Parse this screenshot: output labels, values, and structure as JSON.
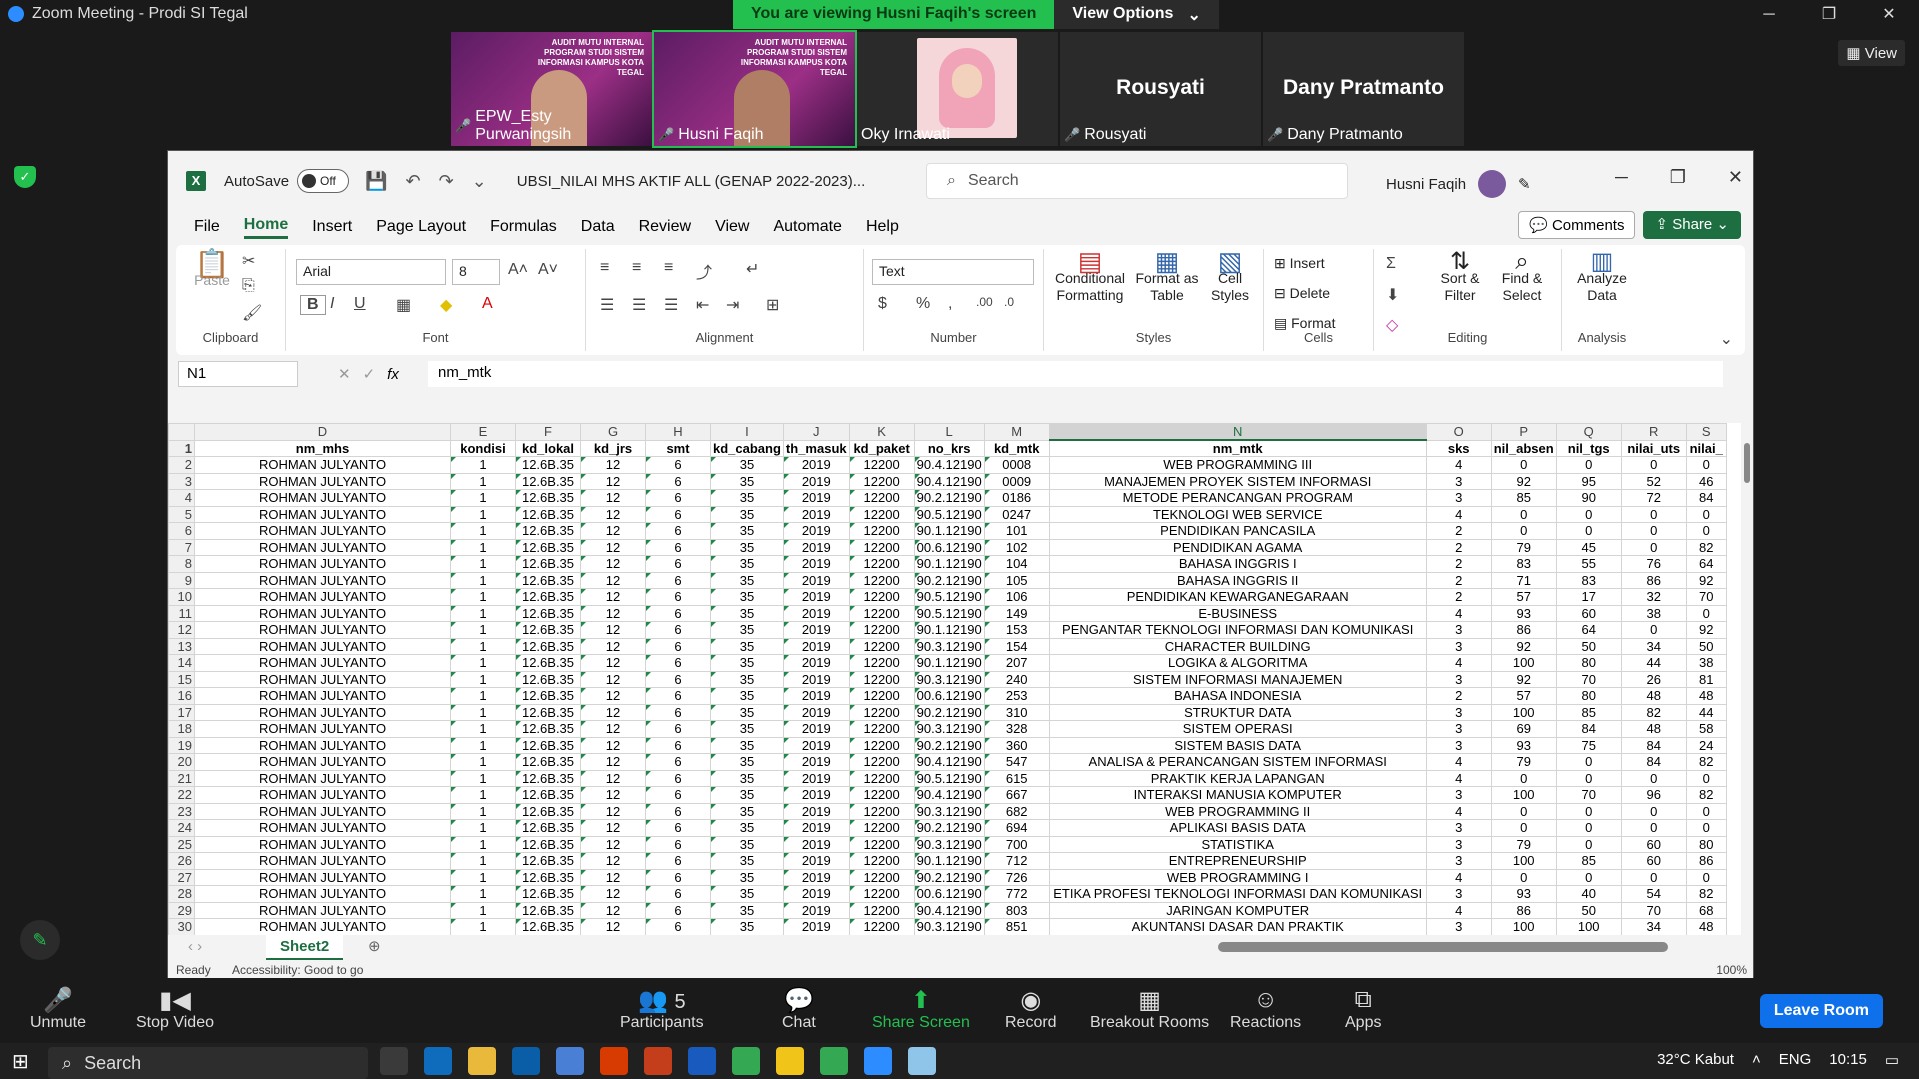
{
  "zoom": {
    "title": "Zoom Meeting - Prodi SI Tegal",
    "viewing": "You are viewing Husni Faqih's screen",
    "view_options": "View Options",
    "view": "View",
    "participants": [
      {
        "name": "EPW_Esty Purwaningsih",
        "type": "video",
        "header": "AUDIT MUTU INTERNAL PROGRAM STUDI SISTEM INFORMASI KAMPUS KOTA TEGAL"
      },
      {
        "name": "Husni Faqih",
        "type": "video",
        "header": "AUDIT MUTU INTERNAL PROGRAM STUDI SISTEM INFORMASI KAMPUS KOTA TEGAL"
      },
      {
        "name": "Oky Irnawati",
        "type": "photo",
        "header": ""
      },
      {
        "name": "Rousyati",
        "type": "name",
        "header": "Rousyati"
      },
      {
        "name": "Dany Pratmanto",
        "type": "name",
        "header": "Dany Pratmanto"
      }
    ],
    "toolbar": {
      "unmute": "Unmute",
      "stop_video": "Stop Video",
      "participants": "Participants",
      "participants_count": "5",
      "chat": "Chat",
      "share": "Share Screen",
      "record": "Record",
      "breakout": "Breakout Rooms",
      "reactions": "Reactions",
      "apps": "Apps",
      "leave": "Leave Room"
    }
  },
  "excel": {
    "autosave": "AutoSave",
    "autosave_state": "Off",
    "doc": "UBSI_NILAI MHS AKTIF ALL (GENAP 2022-2023)...",
    "search": "Search",
    "user": "Husni Faqih",
    "tabs": [
      "File",
      "Home",
      "Insert",
      "Page Layout",
      "Formulas",
      "Data",
      "Review",
      "View",
      "Automate",
      "Help"
    ],
    "comments": "Comments",
    "share": "Share",
    "ribbon": {
      "paste": "Paste",
      "clipboard": "Clipboard",
      "font_name": "Arial",
      "font_size": "8",
      "font": "Font",
      "alignment": "Alignment",
      "num_format": "Text",
      "number": "Number",
      "cond_fmt": "Conditional Formatting",
      "fmt_table": "Format as Table",
      "cell_styles": "Cell Styles",
      "styles": "Styles",
      "insert": "Insert",
      "delete": "Delete",
      "format": "Format",
      "cells": "Cells",
      "sort": "Sort & Filter",
      "find": "Find & Select",
      "editing": "Editing",
      "analyze": "Analyze Data",
      "analysis": "Analysis"
    },
    "namebox": "N1",
    "formula": "nm_mtk",
    "columns": [
      "D",
      "E",
      "F",
      "G",
      "H",
      "I",
      "J",
      "K",
      "L",
      "M",
      "N",
      "O",
      "P",
      "Q",
      "R",
      "S"
    ],
    "headers": [
      "nm_mhs",
      "kondisi",
      "kd_lokal",
      "kd_jrs",
      "smt",
      "kd_cabang",
      "th_masuk",
      "kd_paket",
      "no_krs",
      "kd_mtk",
      "nm_mtk",
      "sks",
      "nil_absen",
      "nil_tgs",
      "nilai_uts",
      "nilai_"
    ],
    "rows": [
      [
        "0008",
        "WEB PROGRAMMING III",
        "4",
        "0",
        "0",
        "0",
        "0",
        "90.4.12190"
      ],
      [
        "0009",
        "MANAJEMEN PROYEK SISTEM INFORMASI",
        "3",
        "92",
        "95",
        "52",
        "46",
        "90.4.12190"
      ],
      [
        "0186",
        "METODE PERANCANGAN PROGRAM",
        "3",
        "85",
        "90",
        "72",
        "84",
        "90.2.12190"
      ],
      [
        "0247",
        "TEKNOLOGI WEB SERVICE",
        "4",
        "0",
        "0",
        "0",
        "0",
        "90.5.12190"
      ],
      [
        "101",
        "PENDIDIKAN PANCASILA",
        "2",
        "0",
        "0",
        "0",
        "0",
        "90.1.12190"
      ],
      [
        "102",
        "PENDIDIKAN AGAMA",
        "2",
        "79",
        "45",
        "0",
        "82",
        "00.6.12190"
      ],
      [
        "104",
        "BAHASA INGGRIS I",
        "2",
        "83",
        "55",
        "76",
        "64",
        "90.1.12190"
      ],
      [
        "105",
        "BAHASA INGGRIS II",
        "2",
        "71",
        "83",
        "86",
        "92",
        "90.2.12190"
      ],
      [
        "106",
        "PENDIDIKAN KEWARGANEGARAAN",
        "2",
        "57",
        "17",
        "32",
        "70",
        "90.5.12190"
      ],
      [
        "149",
        "E-BUSINESS",
        "4",
        "93",
        "60",
        "38",
        "0",
        "90.5.12190"
      ],
      [
        "153",
        "PENGANTAR TEKNOLOGI INFORMASI DAN KOMUNIKASI",
        "3",
        "86",
        "64",
        "0",
        "92",
        "90.1.12190"
      ],
      [
        "154",
        "CHARACTER BUILDING",
        "3",
        "92",
        "50",
        "34",
        "50",
        "90.3.12190"
      ],
      [
        "207",
        "LOGIKA & ALGORITMA",
        "4",
        "100",
        "80",
        "44",
        "38",
        "90.1.12190"
      ],
      [
        "240",
        "SISTEM INFORMASI MANAJEMEN",
        "3",
        "92",
        "70",
        "26",
        "81",
        "90.3.12190"
      ],
      [
        "253",
        "BAHASA INDONESIA",
        "2",
        "57",
        "80",
        "48",
        "48",
        "00.6.12190"
      ],
      [
        "310",
        "STRUKTUR DATA",
        "3",
        "100",
        "85",
        "82",
        "44",
        "90.2.12190"
      ],
      [
        "328",
        "SISTEM OPERASI",
        "3",
        "69",
        "84",
        "48",
        "58",
        "90.3.12190"
      ],
      [
        "360",
        "SISTEM BASIS DATA",
        "3",
        "93",
        "75",
        "84",
        "24",
        "90.2.12190"
      ],
      [
        "547",
        "ANALISA & PERANCANGAN SISTEM INFORMASI",
        "4",
        "79",
        "0",
        "84",
        "82",
        "90.4.12190"
      ],
      [
        "615",
        "PRAKTIK KERJA LAPANGAN",
        "4",
        "0",
        "0",
        "0",
        "0",
        "90.5.12190"
      ],
      [
        "667",
        "INTERAKSI MANUSIA KOMPUTER",
        "3",
        "100",
        "70",
        "96",
        "82",
        "90.4.12190"
      ],
      [
        "682",
        "WEB PROGRAMMING II",
        "4",
        "0",
        "0",
        "0",
        "0",
        "90.3.12190"
      ],
      [
        "694",
        "APLIKASI BASIS DATA",
        "3",
        "0",
        "0",
        "0",
        "0",
        "90.2.12190"
      ],
      [
        "700",
        "STATISTIKA",
        "3",
        "79",
        "0",
        "60",
        "80",
        "90.3.12190"
      ],
      [
        "712",
        "ENTREPRENEURSHIP",
        "3",
        "100",
        "85",
        "60",
        "86",
        "90.1.12190"
      ],
      [
        "726",
        "WEB PROGRAMMING I",
        "4",
        "0",
        "0",
        "0",
        "0",
        "90.2.12190"
      ],
      [
        "772",
        "ETIKA PROFESI TEKNOLOGI INFORMASI DAN KOMUNIKASI",
        "3",
        "93",
        "40",
        "54",
        "82",
        "00.6.12190"
      ],
      [
        "803",
        "JARINGAN KOMPUTER",
        "4",
        "86",
        "50",
        "70",
        "68",
        "90.4.12190"
      ],
      [
        "851",
        "AKUNTANSI DASAR DAN PRAKTIK",
        "3",
        "100",
        "100",
        "34",
        "48",
        "90.3.12190"
      ]
    ],
    "common": {
      "nm_mhs": "ROHMAN JULYANTO",
      "kondisi": "1",
      "kd_lokal": "12.6B.35",
      "kd_jrs": "12",
      "smt": "6",
      "kd_cabang": "35",
      "th_masuk": "2019",
      "kd_paket": "12200"
    },
    "sheet": "Sheet2",
    "status": "Ready",
    "accessibility": "Accessibility: Good to go",
    "zoom": "100%"
  },
  "taskbar": {
    "search": "Search",
    "weather": "32°C Kabut",
    "lang": "ENG",
    "time": "10:15"
  }
}
